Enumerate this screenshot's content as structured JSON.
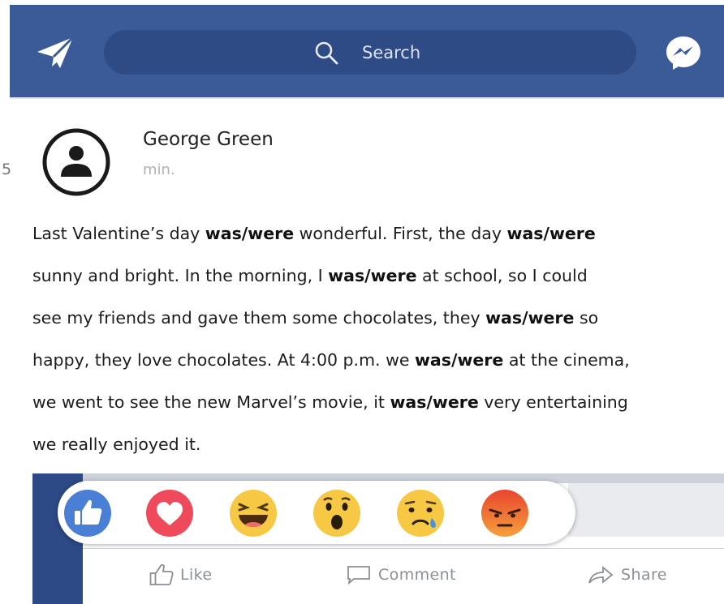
{
  "header": {
    "search_placeholder": "Search",
    "icons": [
      "send-icon",
      "search-icon",
      "messenger-icon"
    ],
    "colors": {
      "bar": "#3b5a98",
      "search_pill": "#2f4b86"
    }
  },
  "margin_number": "5",
  "post": {
    "author": "George Green",
    "time": "min.",
    "lines": [
      [
        "Last Valentine’s day ",
        "was/were",
        "  wonderful. First, the day  ",
        "was/were"
      ],
      [
        "sunny and bright. In the morning, I  ",
        "was/were",
        " at school, so I could"
      ],
      [
        "see my friends and gave them some chocolates, they  ",
        "was/were",
        "  so"
      ],
      [
        "happy, they love chocolates. At 4:00 p.m. we ",
        "was/were",
        " at the cinema,"
      ],
      [
        "we went to see the new Marvel’s movie, it ",
        "was/were",
        " very entertaining"
      ],
      [
        "we really enjoyed it."
      ]
    ]
  },
  "reactions": [
    {
      "name": "like-reaction",
      "color": "#4a7fd6"
    },
    {
      "name": "love-reaction",
      "color": "#ee4a5c"
    },
    {
      "name": "haha-reaction",
      "color": "#f7c843"
    },
    {
      "name": "wow-reaction",
      "color": "#f7c843"
    },
    {
      "name": "sad-reaction",
      "color": "#f7c843"
    },
    {
      "name": "angry-reaction",
      "color": "#ef6a3a"
    }
  ],
  "actions": {
    "like_label": "Like",
    "comment_label": "Comment",
    "share_label": "Share"
  }
}
